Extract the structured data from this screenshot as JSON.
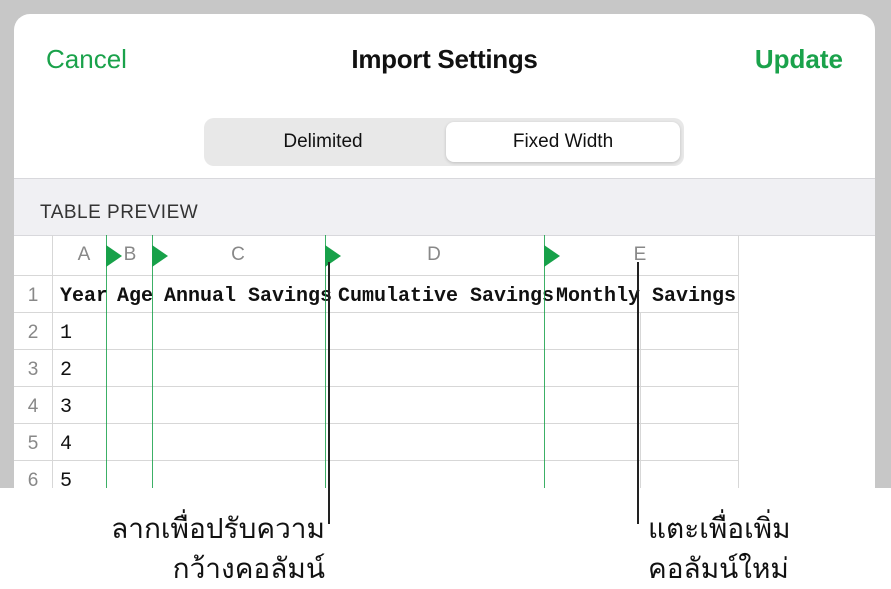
{
  "header": {
    "cancel_label": "Cancel",
    "title": "Import Settings",
    "update_label": "Update"
  },
  "segmented": {
    "options": [
      "Delimited",
      "Fixed Width"
    ],
    "selected": "Fixed Width"
  },
  "preview": {
    "section_label": "TABLE PREVIEW",
    "column_letters": [
      "A",
      "B",
      "C",
      "D",
      "E"
    ],
    "row_numbers": [
      "1",
      "2",
      "3",
      "4",
      "5",
      "6"
    ],
    "header_row": [
      "Year",
      "Age",
      "Annual Savings",
      "Cumulative Savings",
      "Monthly Savings"
    ],
    "year_values": [
      "1",
      "2",
      "3",
      "4",
      "5"
    ]
  },
  "callouts": {
    "drag_line1": "ลากเพื่อปรับความ",
    "drag_line2": "กว้างคอลัมน์",
    "tap_line1": "แตะเพื่อเพิ่ม",
    "tap_line2": "คอลัมน์ใหม่"
  },
  "colors": {
    "accent": "#1aa24b",
    "backdrop": "#c7c7c7"
  }
}
